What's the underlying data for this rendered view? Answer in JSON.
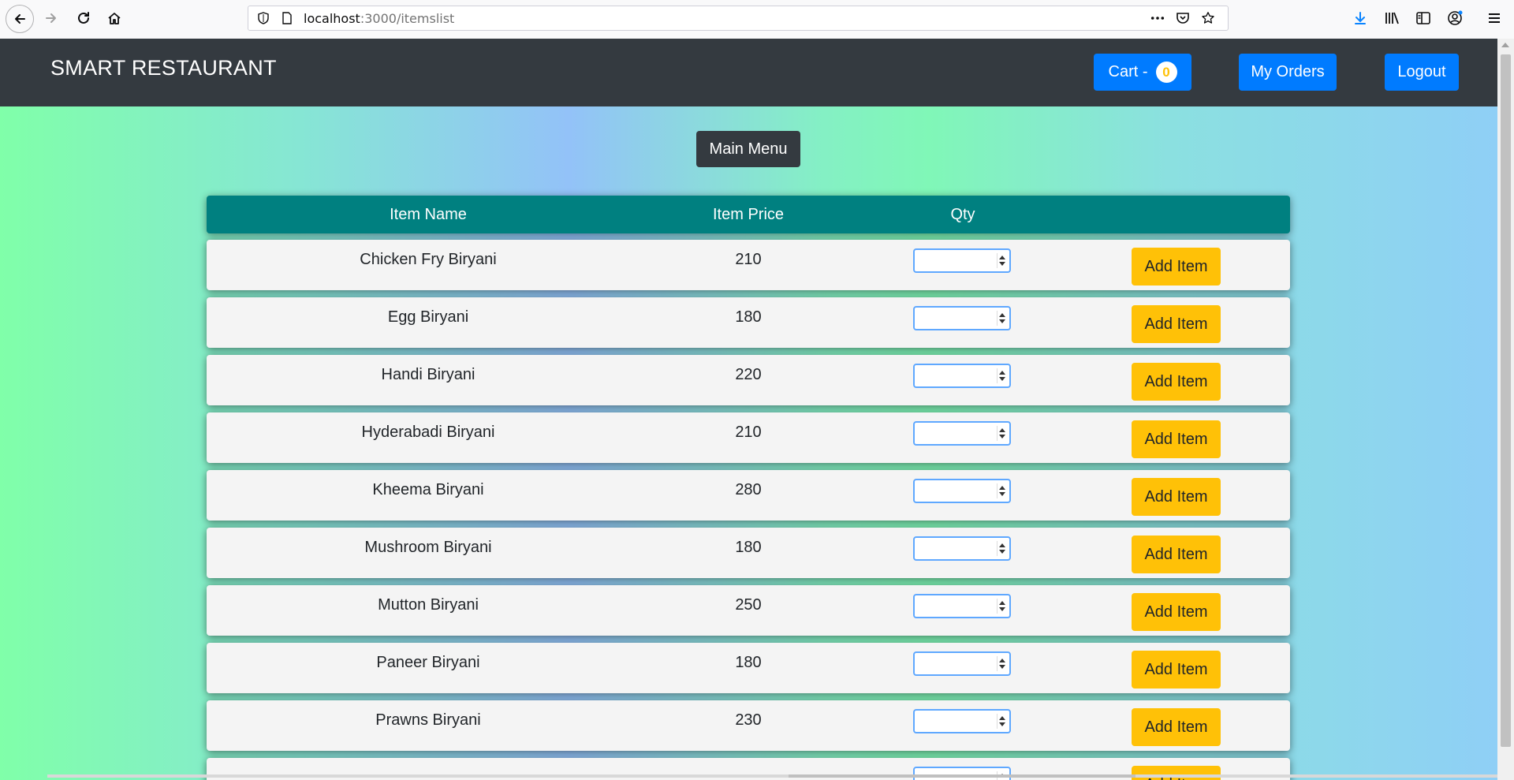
{
  "browser": {
    "url_host": "localhost",
    "url_path": ":3000/itemslist"
  },
  "navbar": {
    "brand": "SMART RESTAURANT",
    "cart_label": "Cart -",
    "cart_count": "0",
    "my_orders": "My Orders",
    "logout": "Logout"
  },
  "main_menu": "Main Menu",
  "table": {
    "headers": [
      "Item Name",
      "Item Price",
      "Qty"
    ],
    "add_label": "Add Item",
    "rows": [
      {
        "name": "Chicken Fry Biryani",
        "price": "210"
      },
      {
        "name": "Egg Biryani",
        "price": "180"
      },
      {
        "name": "Handi Biryani",
        "price": "220"
      },
      {
        "name": "Hyderabadi Biryani",
        "price": "210"
      },
      {
        "name": "Kheema Biryani",
        "price": "280"
      },
      {
        "name": "Mushroom Biryani",
        "price": "180"
      },
      {
        "name": "Mutton Biryani",
        "price": "250"
      },
      {
        "name": "Paneer Biryani",
        "price": "180"
      },
      {
        "name": "Prawns Biryani",
        "price": "230"
      }
    ]
  },
  "colors": {
    "navbar": "#343a40",
    "primary": "#007bff",
    "warning": "#ffc107",
    "table_header": "#008080"
  }
}
